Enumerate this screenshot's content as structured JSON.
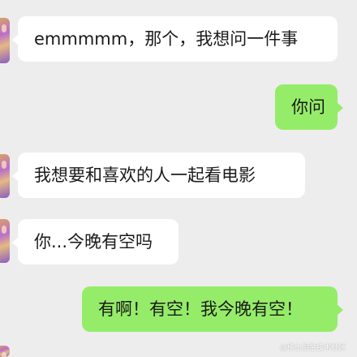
{
  "messages": [
    {
      "direction": "incoming",
      "text": "emmmmm，那个，我想问一件事"
    },
    {
      "direction": "outgoing",
      "text": "你问"
    },
    {
      "direction": "incoming",
      "text": "我想要和喜欢的人一起看电影"
    },
    {
      "direction": "incoming",
      "text": "你...今晚有空吗"
    },
    {
      "direction": "outgoing",
      "text": "有啊！有空！我今晚有空！"
    }
  ],
  "watermark": "@稀土掘金技术社区",
  "colors": {
    "background": "#ededed",
    "incoming_bubble": "#ffffff",
    "outgoing_bubble": "#95ec69"
  }
}
